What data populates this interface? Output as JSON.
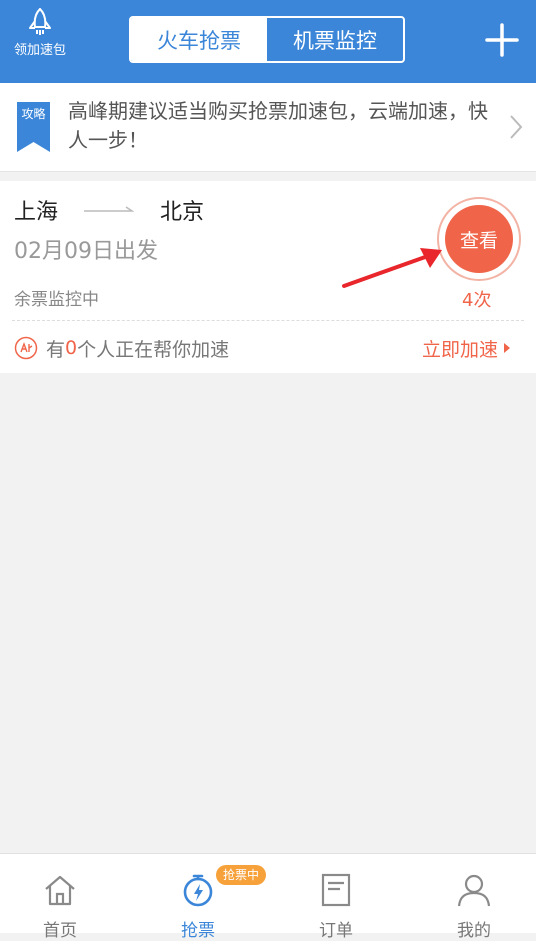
{
  "header": {
    "boost_pack_label": "领加速包",
    "tabs": [
      {
        "label": "火车抢票",
        "active": true
      },
      {
        "label": "机票监控",
        "active": false
      }
    ]
  },
  "tip": {
    "ribbon_text": "攻略",
    "text": "高峰期建议适当购买抢票加速包，云端加速，快人一步！"
  },
  "monitor": {
    "from": "上海",
    "to": "北京",
    "date": "02月09日出发",
    "status": "余票监控中",
    "view_label": "查看",
    "count": "4次",
    "helpers_prefix": "有",
    "helpers_count": "0",
    "helpers_suffix": "个人正在帮你加速",
    "speed_up_label": "立即加速"
  },
  "nav": {
    "items": [
      {
        "label": "首页",
        "icon": "home-icon"
      },
      {
        "label": "抢票",
        "icon": "stopwatch-icon",
        "active": true
      },
      {
        "label": "订单",
        "icon": "document-icon"
      },
      {
        "label": "我的",
        "icon": "user-icon"
      }
    ],
    "badge": "抢票中"
  },
  "colors": {
    "primary": "#3b86d8",
    "accent": "#f0654a",
    "badge": "#f7a13b"
  }
}
